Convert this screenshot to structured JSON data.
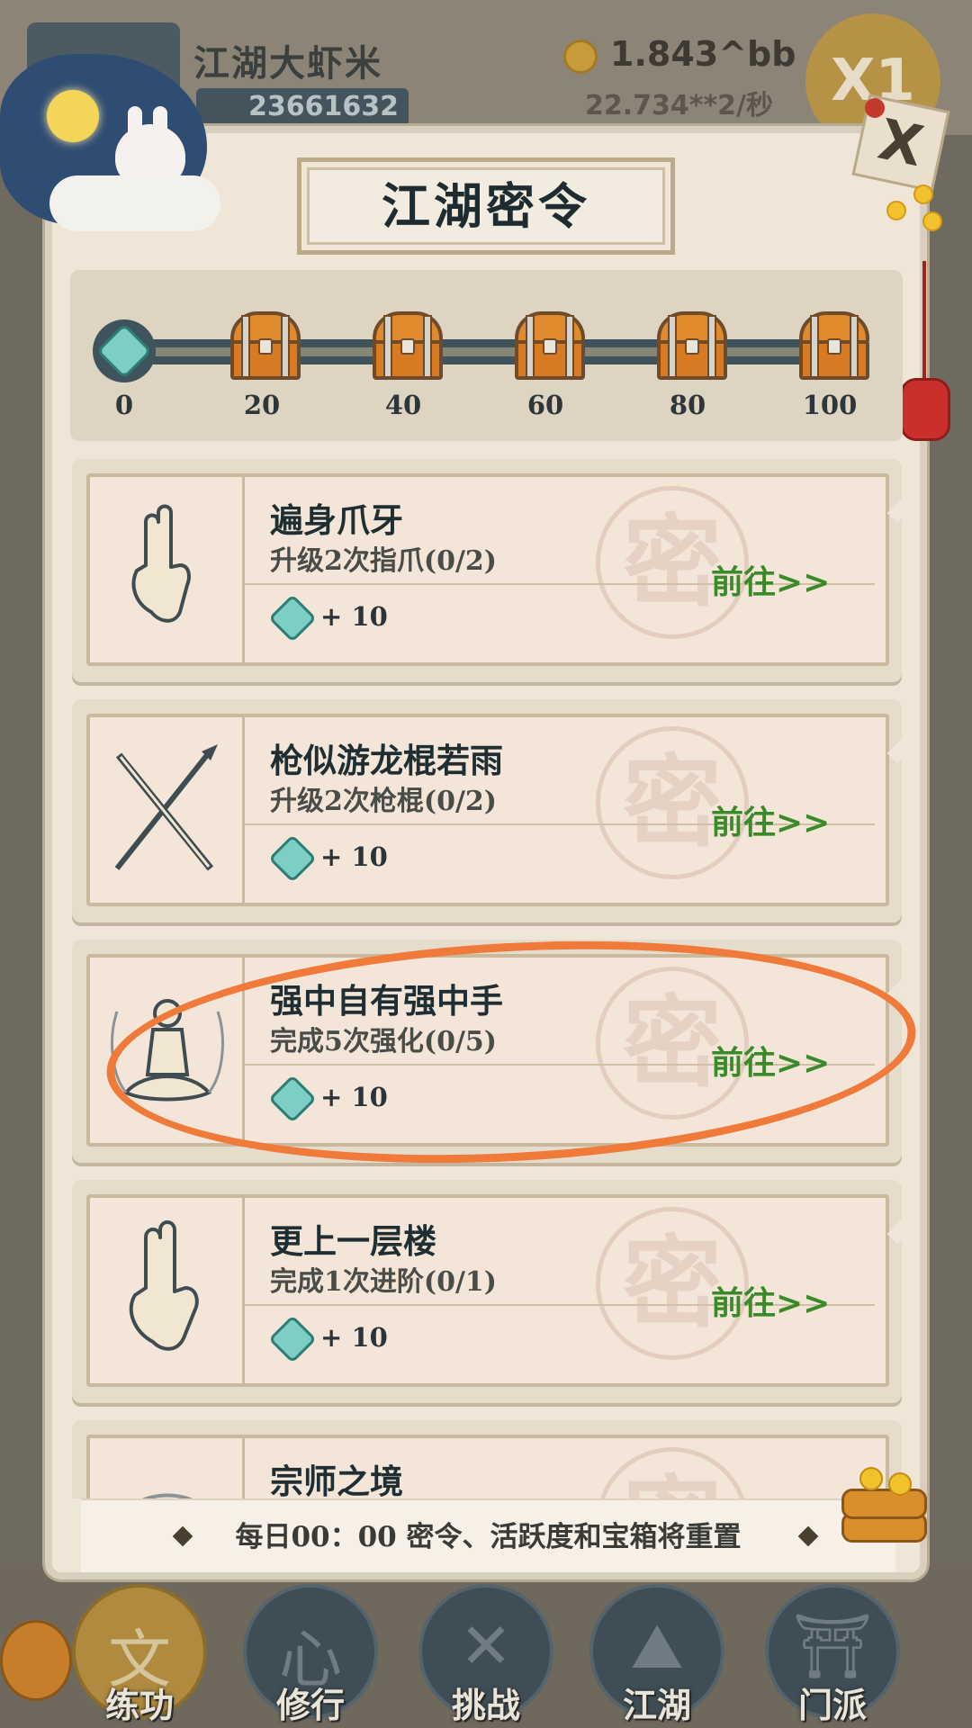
{
  "player": {
    "name": "江湖大虾米",
    "id": "23661632",
    "coins": "1.843^bb",
    "rate": "22.734**2/秒",
    "multiplier": "X1"
  },
  "dialog": {
    "title": "江湖密令",
    "close_label": "X"
  },
  "progress": {
    "current": 0,
    "max": 100,
    "milestones": [
      "0",
      "20",
      "40",
      "60",
      "80",
      "100"
    ]
  },
  "tasks": [
    {
      "name": "遍身爪牙",
      "requirement": "升级2次指爪(0/2)",
      "reward": "+ 10",
      "action": "前往>>",
      "icon": "hand-claw-icon",
      "stamp": "密"
    },
    {
      "name": "枪似游龙棍若雨",
      "requirement": "升级2次枪棍(0/2)",
      "reward": "+ 10",
      "action": "前往>>",
      "icon": "crossed-spear-staff-icon",
      "stamp": "密"
    },
    {
      "name": "强中自有强中手",
      "requirement": "完成5次强化(0/5)",
      "reward": "+ 10",
      "action": "前往>>",
      "icon": "meditating-monk-icon",
      "stamp": "密"
    },
    {
      "name": "更上一层楼",
      "requirement": "完成1次进阶(0/1)",
      "reward": "+ 10",
      "action": "前往>>",
      "icon": "hand-sign-icon",
      "stamp": "密"
    },
    {
      "name": "宗师之境",
      "requirement": "",
      "reward": "",
      "action": "",
      "icon": "master-icon",
      "stamp": "密"
    }
  ],
  "footer": {
    "notice": "每日00：00 密令、活跃度和宝箱将重置"
  },
  "nav": [
    {
      "label": "练功",
      "glyph": "文",
      "icon": "train-icon",
      "active": true
    },
    {
      "label": "修行",
      "glyph": "心",
      "icon": "cultivate-icon",
      "active": false
    },
    {
      "label": "挑战",
      "glyph": "✕",
      "icon": "challenge-icon",
      "active": false
    },
    {
      "label": "江湖",
      "glyph": "⛰",
      "icon": "jianghu-icon",
      "active": false
    },
    {
      "label": "门派",
      "glyph": "⛩",
      "icon": "sect-icon",
      "active": false
    }
  ],
  "colors": {
    "highlight_stroke": "#f07a3a",
    "go_text": "#3b8a2a",
    "gem": "#7ccfc2"
  }
}
